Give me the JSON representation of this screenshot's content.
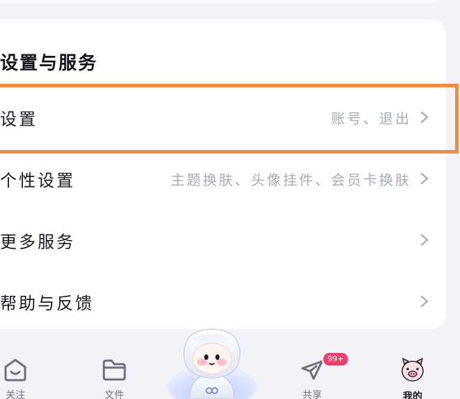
{
  "section": {
    "title": "设置与服务"
  },
  "rows": [
    {
      "label": "设置",
      "value": "账号、退出"
    },
    {
      "label": "个性设置",
      "value": "主题换肤、头像挂件、会员卡换肤"
    },
    {
      "label": "更多服务",
      "value": ""
    },
    {
      "label": "帮助与反馈",
      "value": ""
    }
  ],
  "nav": {
    "items": [
      {
        "label": "关注",
        "icon": "smile-home-icon"
      },
      {
        "label": "文件",
        "icon": "folder-icon"
      },
      {
        "label": "共享",
        "icon": "paper-plane-icon",
        "badge": "99+"
      },
      {
        "label": "我的",
        "icon": "pig-avatar-icon"
      }
    ]
  },
  "colors": {
    "highlight": "#ef8c3e",
    "badge": "#f0406a",
    "value_text": "#a7acb8"
  }
}
